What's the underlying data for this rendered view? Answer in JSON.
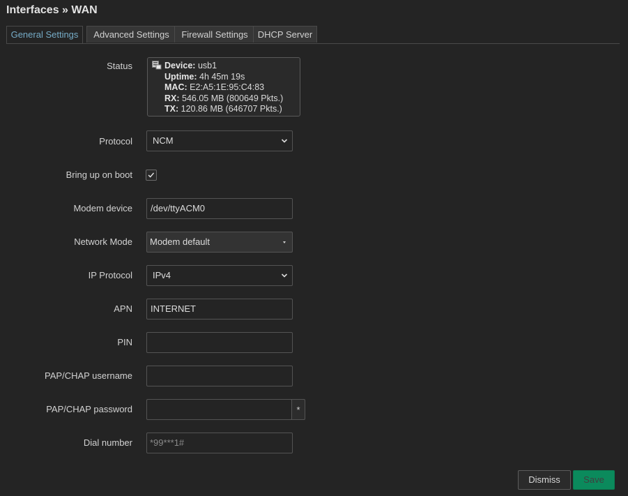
{
  "header": {
    "title": "Interfaces » WAN"
  },
  "tabs": [
    {
      "label": "General Settings",
      "active": true
    },
    {
      "label": "Advanced Settings",
      "active": false
    },
    {
      "label": "Firewall Settings",
      "active": false
    },
    {
      "label": "DHCP Server",
      "active": false
    }
  ],
  "status": {
    "label": "Status",
    "device_key": "Device:",
    "device_val": " usb1",
    "uptime_key": "Uptime:",
    "uptime_val": " 4h 45m 19s",
    "mac_key": "MAC:",
    "mac_val": " E2:A5:1E:95:C4:83",
    "rx_key": "RX:",
    "rx_val": " 546.05 MB (800649 Pkts.)",
    "tx_key": "TX:",
    "tx_val": " 120.86 MB (646707 Pkts.)"
  },
  "form": {
    "protocol": {
      "label": "Protocol",
      "value": "NCM"
    },
    "boot": {
      "label": "Bring up on boot",
      "checked": true
    },
    "modem_device": {
      "label": "Modem device",
      "value": "/dev/ttyACM0"
    },
    "network_mode": {
      "label": "Network Mode",
      "value": "Modem default"
    },
    "ip_protocol": {
      "label": "IP Protocol",
      "value": "IPv4"
    },
    "apn": {
      "label": "APN",
      "value": "INTERNET"
    },
    "pin": {
      "label": "PIN",
      "value": ""
    },
    "username": {
      "label": "PAP/CHAP username",
      "value": ""
    },
    "password": {
      "label": "PAP/CHAP password",
      "value": "",
      "reveal": "*"
    },
    "dial": {
      "label": "Dial number",
      "placeholder": "*99***1#"
    }
  },
  "footer": {
    "dismiss": "Dismiss",
    "save": "Save"
  },
  "colors": {
    "accent": "#76acc7",
    "save": "#0b8a5c",
    "background": "#242424"
  }
}
